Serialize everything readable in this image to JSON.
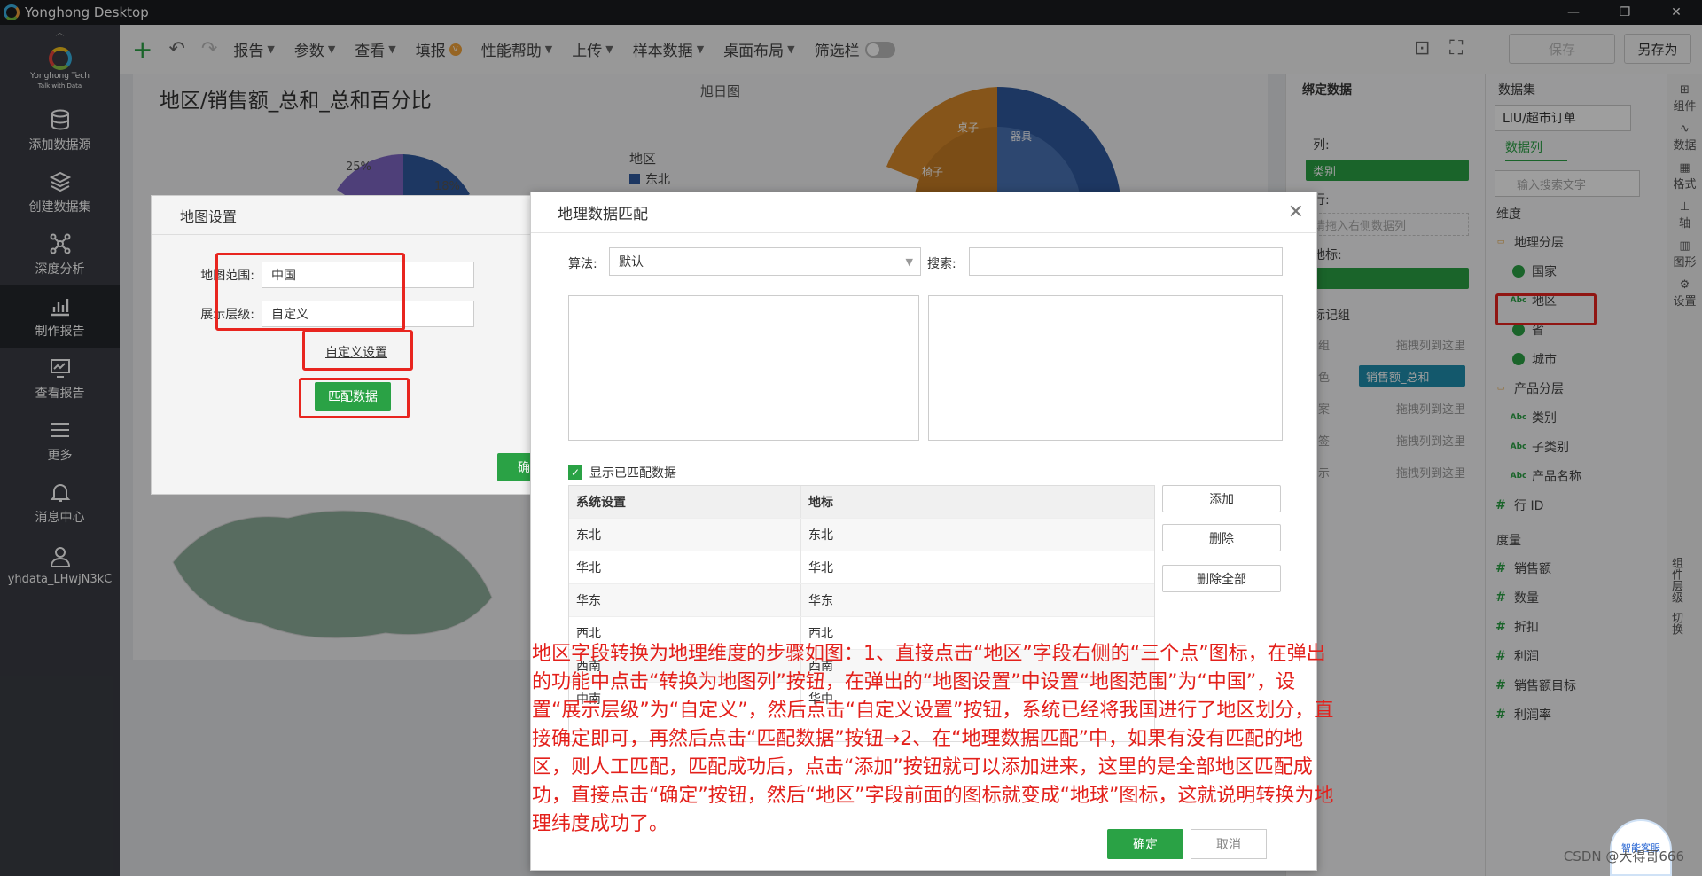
{
  "window": {
    "title": "Yonghong Desktop",
    "controls": [
      "—",
      "❐",
      "✕"
    ]
  },
  "nav": {
    "brand": "Yonghong Tech",
    "brand_sub": "Talk with Data",
    "items": [
      {
        "label": "添加数据源",
        "icon": "database-icon"
      },
      {
        "label": "创建数据集",
        "icon": "layers-icon"
      },
      {
        "label": "深度分析",
        "icon": "network-icon"
      },
      {
        "label": "制作报告",
        "icon": "chart-icon"
      },
      {
        "label": "查看报告",
        "icon": "monitor-icon"
      },
      {
        "label": "更多",
        "icon": "menu-icon"
      },
      {
        "label": "消息中心",
        "icon": "bell-icon"
      },
      {
        "label": "yhdata_LHwjN3kC",
        "icon": "user-icon"
      }
    ]
  },
  "toolbar": {
    "menus": [
      "报告",
      "参数",
      "查看",
      "填报",
      "性能帮助",
      "上传",
      "样本数据",
      "桌面布局",
      "筛选栏"
    ],
    "save": "保存",
    "save_as": "另存为"
  },
  "report": {
    "title": "地区/销售额_总和_总和百分比",
    "sunburst_title": "旭日图",
    "pie_pct_1": "25%",
    "pie_pct_2": "18%",
    "legend_title": "地区",
    "legend_item": "东北",
    "sun_labels": [
      "椅子",
      "桌子",
      "器具"
    ]
  },
  "bind_panel": {
    "title": "绑定数据",
    "columns_label": "列:",
    "columns_value": "类别",
    "rows_label": "行:",
    "rows_placeholder": "请拖入右侧数据列",
    "geo_label": "地标:",
    "marks_label": "标记组",
    "mark_rows": [
      {
        "label": "组",
        "value": "拖拽列到这里"
      },
      {
        "label": "色",
        "value": "销售额_总和"
      },
      {
        "label": "案",
        "value": "拖拽列到这里"
      },
      {
        "label": "签",
        "value": "拖拽列到这里"
      },
      {
        "label": "示",
        "value": "拖拽列到这里"
      }
    ]
  },
  "dataset_panel": {
    "title": "数据集",
    "dataset": "LIU/超市订单",
    "tab": "数据列",
    "search_placeholder": "输入搜索文字",
    "dim_title": "维度",
    "dims": [
      {
        "label": "地理分层",
        "kind": "folder",
        "level": 0
      },
      {
        "label": "国家",
        "kind": "globe",
        "level": 1
      },
      {
        "label": "地区",
        "kind": "abc",
        "level": 1
      },
      {
        "label": "省",
        "kind": "globe",
        "level": 1
      },
      {
        "label": "城市",
        "kind": "globe",
        "level": 1
      },
      {
        "label": "产品分层",
        "kind": "folder",
        "level": 0
      },
      {
        "label": "类别",
        "kind": "abc",
        "level": 1
      },
      {
        "label": "子类别",
        "kind": "abc",
        "level": 1
      },
      {
        "label": "产品名称",
        "kind": "abc",
        "level": 1
      },
      {
        "label": "行 ID",
        "kind": "num",
        "level": 0
      }
    ],
    "measure_title": "度量",
    "measures": [
      "销售额",
      "数量",
      "折扣",
      "利润",
      "销售额目标",
      "利润率"
    ]
  },
  "side_tabs": [
    "组件",
    "数据",
    "格式",
    "轴",
    "图形",
    "设置",
    "组件层级",
    "切换"
  ],
  "map_dialog": {
    "title": "地图设置",
    "range_label": "地图范围:",
    "range_value": "中国",
    "level_label": "展示层级:",
    "level_value": "自定义",
    "custom_btn": "自定义设置",
    "match_btn": "匹配数据",
    "ok_btn": "确"
  },
  "geo_dialog": {
    "title": "地理数据匹配",
    "algo_label": "算法:",
    "algo_value": "默认",
    "search_label": "搜索:",
    "show_matched": "显示已匹配数据",
    "col1": "系统设置",
    "col2": "地标",
    "rows": [
      [
        "东北",
        "东北"
      ],
      [
        "华北",
        "华北"
      ],
      [
        "华东",
        "华东"
      ],
      [
        "西北",
        "西北"
      ],
      [
        "西南",
        "西南"
      ],
      [
        "中南",
        "华中"
      ]
    ],
    "add": "添加",
    "delete": "删除",
    "delete_all": "删除全部",
    "confirm": "确定",
    "cancel": "取消"
  },
  "annotation": "地区字段转换为地理维度的步骤如图：1、直接点击“地区”字段右侧的“三个点”图标，在弹出的功能中点击“转换为地图列”按钮，在弹出的“地图设置”中设置“地图范围”为“中国”，设置“展示层级”为“自定义”，然后点击“自定义设置”按钮，系统已经将我国进行了地区划分，直接确定即可，再然后点击“匹配数据”按钮→2、在“地理数据匹配”中，如果有没有匹配的地区，则人工匹配，匹配成功后，点击“添加”按钮就可以添加进来，这里的是全部地区匹配成功，直接点击“确定”按钮，然后“地区”字段前面的图标就变成“地球”图标，这就说明转换为地理纬度成功了。",
  "watermark": "CSDN @大得哥666",
  "robot_label": "智能客服",
  "colors": {
    "accent_green": "#2aa245",
    "highlight_red": "#e8251f",
    "nav_bg": "#3a3d44"
  }
}
